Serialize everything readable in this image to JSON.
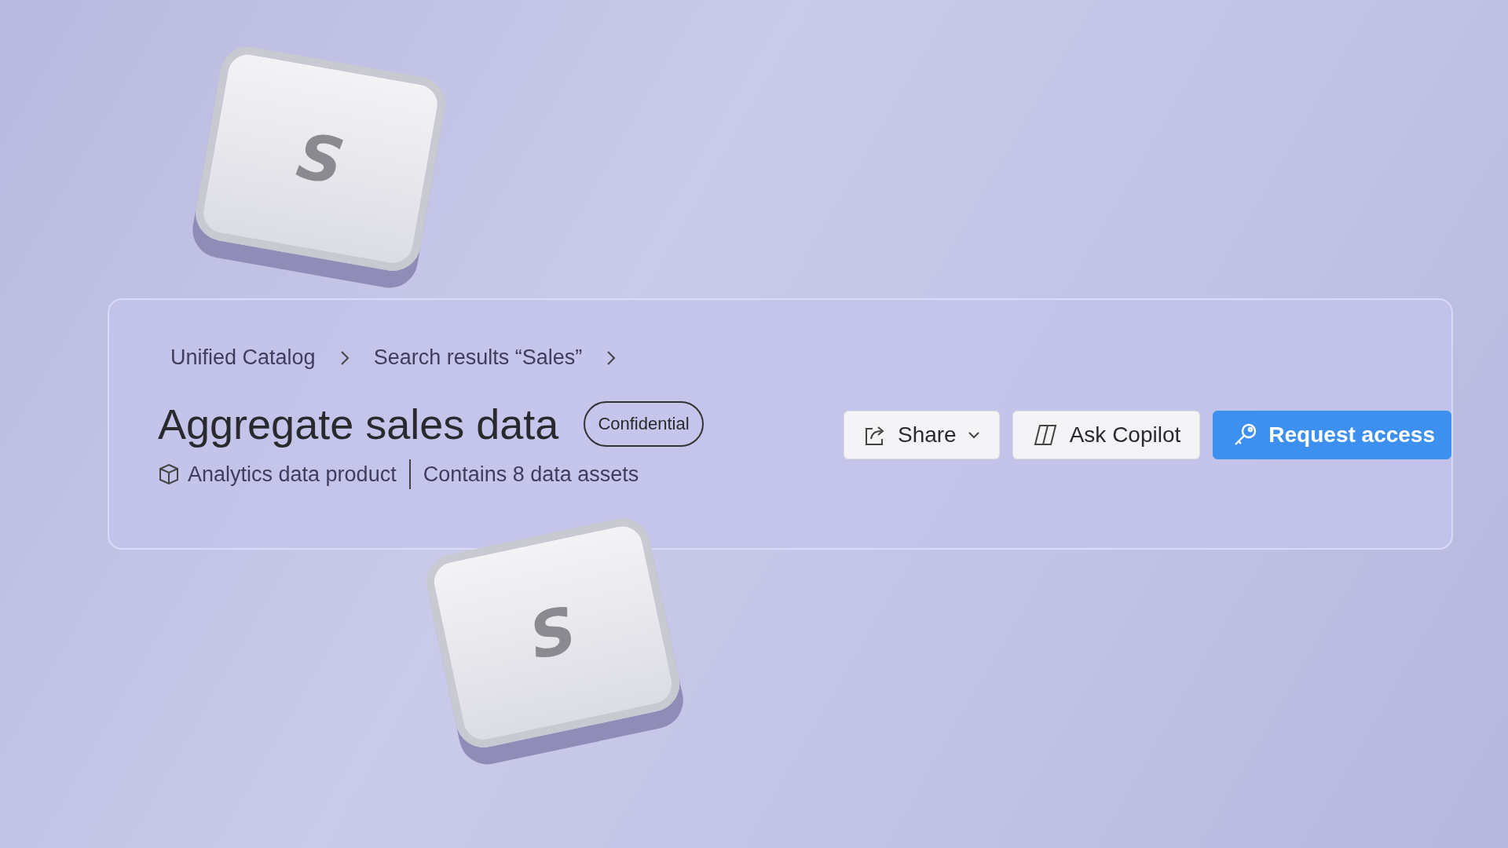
{
  "keys": [
    {
      "label": "S"
    },
    {
      "label": "S"
    }
  ],
  "breadcrumb": [
    {
      "label": "Unified Catalog"
    },
    {
      "label": "Search results “Sales”"
    }
  ],
  "title": "Aggregate sales data",
  "badge": "Confidential",
  "meta": {
    "type": "Analytics data product",
    "assets": "Contains 8 data assets"
  },
  "buttons": [
    {
      "kind": "share",
      "label": "Share"
    },
    {
      "kind": "copilot",
      "label": "Ask Copilot"
    },
    {
      "kind": "primary",
      "label": "Request access"
    }
  ]
}
